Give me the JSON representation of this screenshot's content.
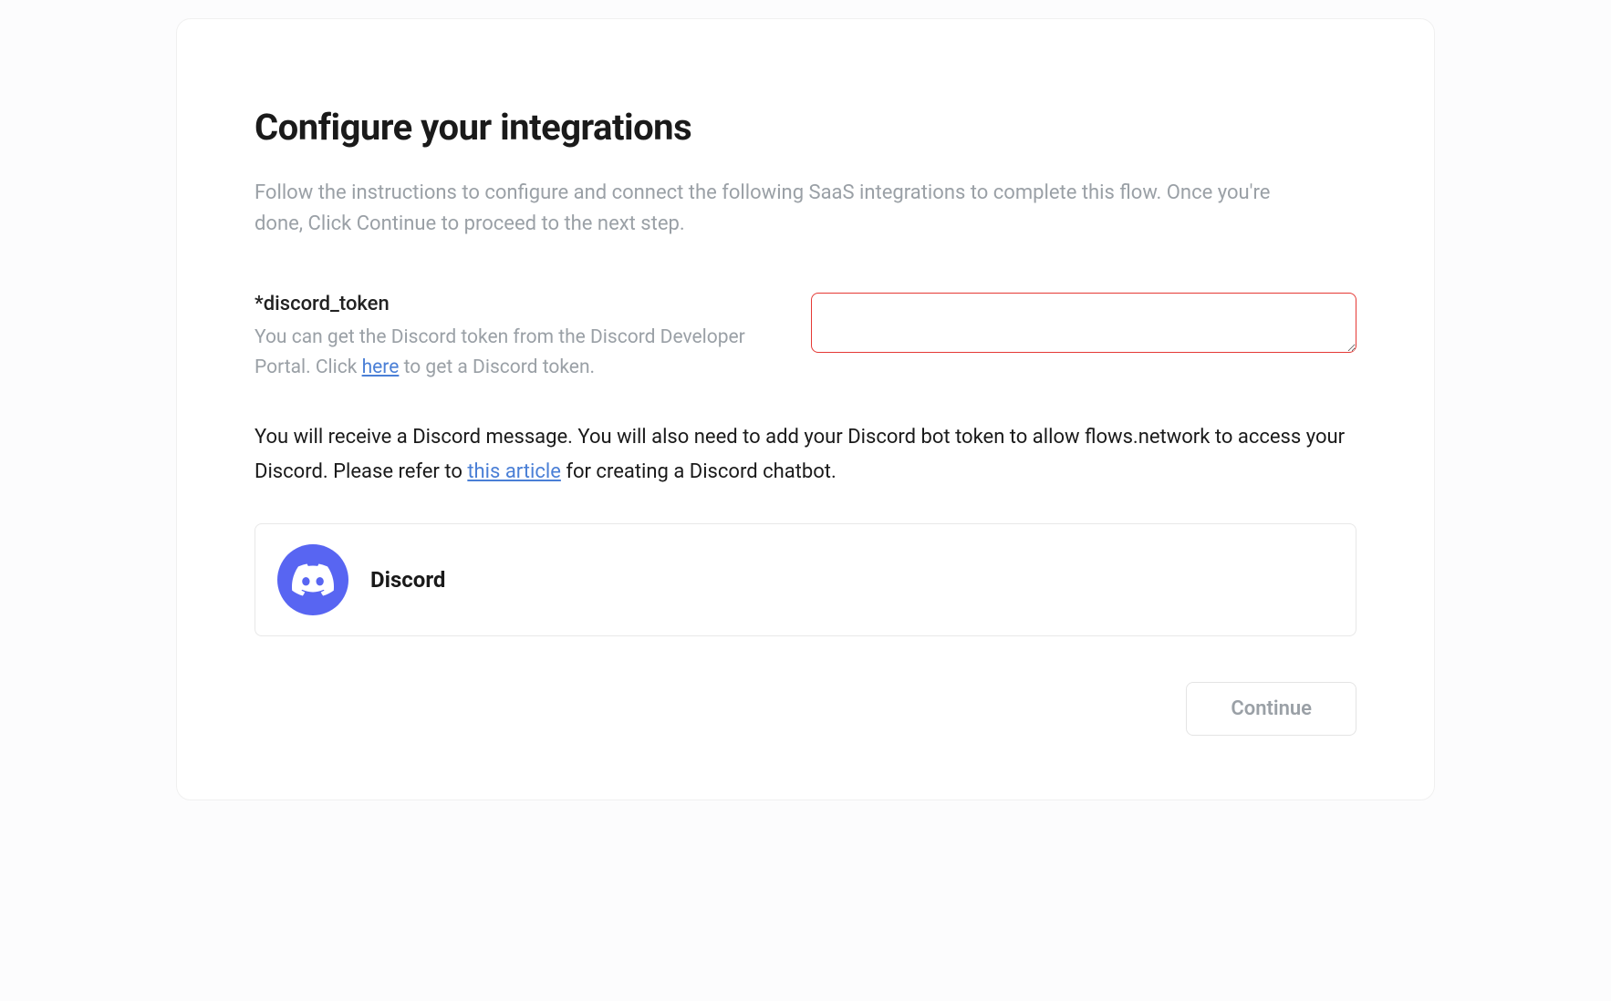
{
  "header": {
    "title": "Configure your integrations",
    "subtitle": "Follow the instructions to configure and connect the following SaaS integrations to complete this flow. Once you're done, Click Continue to proceed to the next step."
  },
  "field": {
    "label": "*discord_token",
    "help_prefix": "You can get the Discord token from the Discord Developer Portal. Click ",
    "help_link_text": "here",
    "help_suffix": " to get a Discord token.",
    "value": ""
  },
  "info": {
    "prefix": "You will receive a Discord message. You will also need to add your Discord bot token to allow flows.network to access your Discord. Please refer to ",
    "link_text": "this article",
    "suffix": " for creating a  Discord chatbot."
  },
  "integration": {
    "name": "Discord"
  },
  "actions": {
    "continue_label": "Continue"
  }
}
